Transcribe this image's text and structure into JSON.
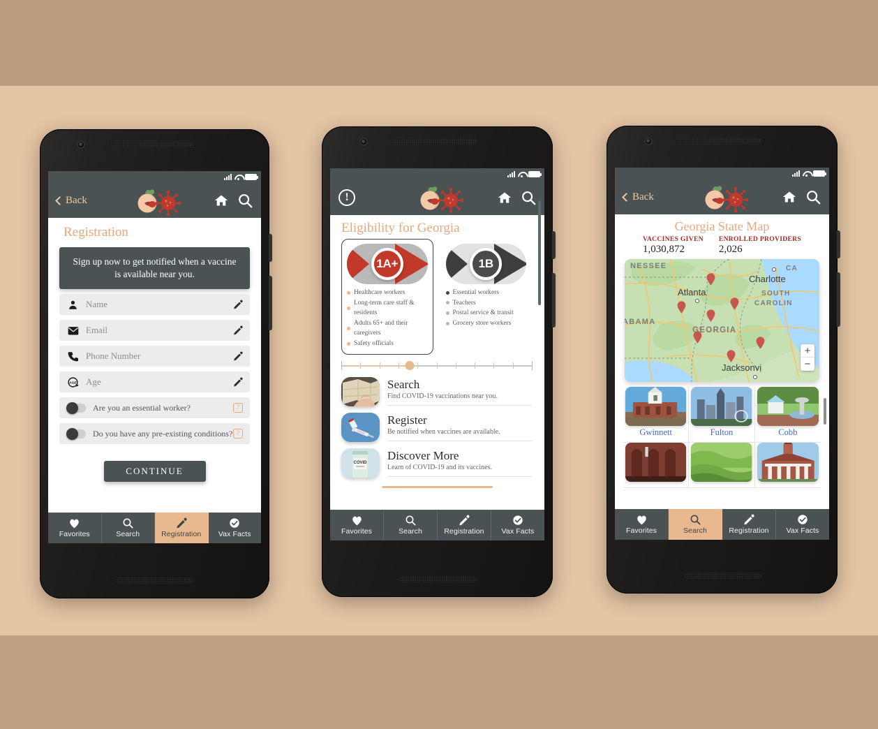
{
  "canvas": {
    "bg_top": "#bd9d80",
    "bg_mid": "#e3c4a3",
    "bg_bottom": "#c2a083"
  },
  "theme": {
    "appbar": "#4b5254",
    "accent_peach": "#e8b98f",
    "title_peach": "#e6a87c",
    "red": "#c0392b",
    "link_blue": "#3a6bd8",
    "stat_red": "#9e2b24"
  },
  "bottom_nav": {
    "items": [
      {
        "label": "Favorites",
        "icon": "heart-icon"
      },
      {
        "label": "Search",
        "icon": "search-icon"
      },
      {
        "label": "Registration",
        "icon": "pencil-icon"
      },
      {
        "label": "Vax Facts",
        "icon": "check-circle-icon"
      }
    ]
  },
  "phone1": {
    "appbar": {
      "back_label": "Back",
      "home_icon": "home-icon",
      "search_icon": "search-icon",
      "logo_icon": "peach-virus-logo"
    },
    "page_title": "Registration",
    "callout": "Sign up now to get notified when a vaccine is available near you.",
    "fields": [
      {
        "placeholder": "Name",
        "icon": "person-icon",
        "edit_icon": "pencil-icon"
      },
      {
        "placeholder": "Email",
        "icon": "envelope-icon",
        "edit_icon": "pencil-icon"
      },
      {
        "placeholder": "Phone Number",
        "icon": "phone-icon",
        "edit_icon": "pencil-icon"
      },
      {
        "placeholder": "Age",
        "icon": "age-icon",
        "edit_icon": "pencil-icon"
      }
    ],
    "toggles": [
      {
        "label": "Are you an essential worker?",
        "state": "off",
        "help": "?"
      },
      {
        "label": "Do you have any pre-existing conditions?",
        "state": "off",
        "help": "?"
      }
    ],
    "continue_label": "CONTINUE",
    "active_tab": "Registration"
  },
  "phone2": {
    "appbar": {
      "alert_icon": "exclamation-circle-icon",
      "home_icon": "home-icon",
      "search_icon": "search-icon",
      "logo_icon": "peach-virus-logo"
    },
    "page_title": "Eligibility for Georgia",
    "phases": [
      {
        "code": "1A+",
        "selected": true,
        "color": "#c0392b",
        "groups": [
          "Healthcare workers",
          "Long-term care staff & residents",
          "Adults 65+ and their caregivers",
          "Safety officials"
        ]
      },
      {
        "code": "1B",
        "selected": false,
        "color": "#4a4a4a",
        "groups": [
          "Essential workers",
          "Teachers",
          "Postal service & transit",
          "Grocery store workers"
        ]
      }
    ],
    "slider": {
      "value_percent": 36,
      "ticks": 11
    },
    "links": [
      {
        "title": "Search",
        "subtitle": "Find COVID-19 vaccinations near you.",
        "image": "map-in-hands-photo"
      },
      {
        "title": "Register",
        "subtitle": "Be notified when vaccines are available.",
        "image": "vaccine-syringe-photo"
      },
      {
        "title": "Discover More",
        "subtitle": "Learn of COVID-19 and its vaccines.",
        "image": "covid-vaccine-vial-photo"
      }
    ],
    "active_tab": ""
  },
  "phone3": {
    "appbar": {
      "back_label": "Back",
      "home_icon": "home-icon",
      "search_icon": "search-icon",
      "logo_icon": "peach-virus-logo"
    },
    "page_title": "Georgia State Map",
    "stats": [
      {
        "label": "VACCINES GIVEN",
        "value": "1,030,872"
      },
      {
        "label": "ENROLLED PROVIDERS",
        "value": "2,026"
      }
    ],
    "map": {
      "state_labels": [
        "NESSEE",
        "ABAMA",
        "GEORGIA",
        "SOUTH",
        "CAROLIN",
        "CA"
      ],
      "cities": [
        "Atlanta",
        "Charlotte",
        "Jacksonvi"
      ],
      "pin_count": 7,
      "zoom_in": "+",
      "zoom_out": "−"
    },
    "counties": [
      {
        "name": "Gwinnett",
        "image": "gwinnett-courthouse-photo"
      },
      {
        "name": "Fulton",
        "image": "atlanta-skyline-photo"
      },
      {
        "name": "Cobb",
        "image": "marietta-square-photo"
      },
      {
        "name": "",
        "image": "brick-church-photo"
      },
      {
        "name": "",
        "image": "green-hills-photo"
      },
      {
        "name": "",
        "image": "county-courthouse-photo"
      }
    ],
    "active_tab": "Search"
  }
}
